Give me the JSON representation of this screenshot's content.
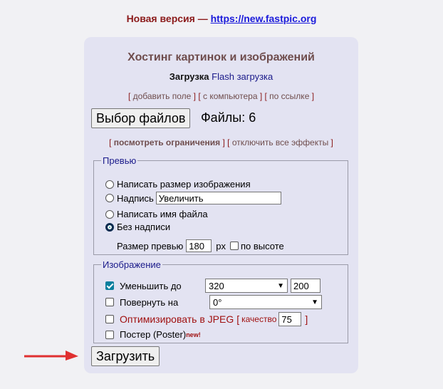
{
  "top": {
    "prefix": "Новая версия — ",
    "link": "https://new.fastpic.org"
  },
  "header": {
    "title": "Хостинг картинок и изображений",
    "upload_label": "Загрузка",
    "flash_link": "Flash загрузка"
  },
  "links1": {
    "add_field": "добавить поле",
    "from_computer": "с компьютера",
    "by_link": "по ссылке"
  },
  "files": {
    "choose_button": "Выбор файлов",
    "count_label": "Файлы: 6"
  },
  "links2": {
    "limits": "посмотреть ограничения",
    "disable_effects": "отключить все эффекты"
  },
  "preview": {
    "legend": "Превью",
    "opt_size": "Написать размер изображения",
    "opt_caption": "Надпись",
    "caption_value": "Увеличить",
    "opt_filename": "Написать имя файла",
    "opt_none": "Без надписи",
    "size_label": "Размер превью",
    "size_value": "180",
    "size_unit": "px",
    "by_height": "по высоте"
  },
  "image": {
    "legend": "Изображение",
    "reduce_label": "Уменьшить до",
    "reduce_select": "320",
    "reduce_value": "200",
    "rotate_label": "Повернуть на",
    "rotate_select": "0°",
    "optimize_label": "Оптимизировать в JPEG",
    "quality_open": "[",
    "quality_label": "качество",
    "quality_value": "75",
    "quality_close": "]",
    "poster_label": "Постер (Poster)",
    "poster_badge": "new!"
  },
  "upload_button": "Загрузить",
  "colors": {
    "panel": "#e3e3f2",
    "arrow": "#e03030",
    "link_blue": "#1a1adb",
    "dark_red": "#8b1a1a"
  }
}
